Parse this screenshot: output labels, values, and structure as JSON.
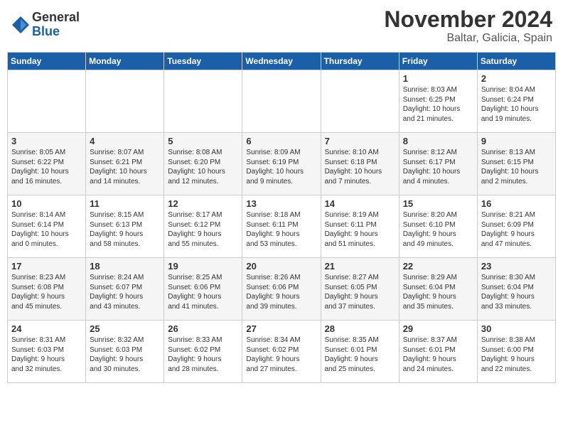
{
  "header": {
    "logo_line1": "General",
    "logo_line2": "Blue",
    "month": "November 2024",
    "location": "Baltar, Galicia, Spain"
  },
  "weekdays": [
    "Sunday",
    "Monday",
    "Tuesday",
    "Wednesday",
    "Thursday",
    "Friday",
    "Saturday"
  ],
  "weeks": [
    [
      {
        "day": "",
        "text": ""
      },
      {
        "day": "",
        "text": ""
      },
      {
        "day": "",
        "text": ""
      },
      {
        "day": "",
        "text": ""
      },
      {
        "day": "",
        "text": ""
      },
      {
        "day": "1",
        "text": "Sunrise: 8:03 AM\nSunset: 6:25 PM\nDaylight: 10 hours\nand 21 minutes."
      },
      {
        "day": "2",
        "text": "Sunrise: 8:04 AM\nSunset: 6:24 PM\nDaylight: 10 hours\nand 19 minutes."
      }
    ],
    [
      {
        "day": "3",
        "text": "Sunrise: 8:05 AM\nSunset: 6:22 PM\nDaylight: 10 hours\nand 16 minutes."
      },
      {
        "day": "4",
        "text": "Sunrise: 8:07 AM\nSunset: 6:21 PM\nDaylight: 10 hours\nand 14 minutes."
      },
      {
        "day": "5",
        "text": "Sunrise: 8:08 AM\nSunset: 6:20 PM\nDaylight: 10 hours\nand 12 minutes."
      },
      {
        "day": "6",
        "text": "Sunrise: 8:09 AM\nSunset: 6:19 PM\nDaylight: 10 hours\nand 9 minutes."
      },
      {
        "day": "7",
        "text": "Sunrise: 8:10 AM\nSunset: 6:18 PM\nDaylight: 10 hours\nand 7 minutes."
      },
      {
        "day": "8",
        "text": "Sunrise: 8:12 AM\nSunset: 6:17 PM\nDaylight: 10 hours\nand 4 minutes."
      },
      {
        "day": "9",
        "text": "Sunrise: 8:13 AM\nSunset: 6:15 PM\nDaylight: 10 hours\nand 2 minutes."
      }
    ],
    [
      {
        "day": "10",
        "text": "Sunrise: 8:14 AM\nSunset: 6:14 PM\nDaylight: 10 hours\nand 0 minutes."
      },
      {
        "day": "11",
        "text": "Sunrise: 8:15 AM\nSunset: 6:13 PM\nDaylight: 9 hours\nand 58 minutes."
      },
      {
        "day": "12",
        "text": "Sunrise: 8:17 AM\nSunset: 6:12 PM\nDaylight: 9 hours\nand 55 minutes."
      },
      {
        "day": "13",
        "text": "Sunrise: 8:18 AM\nSunset: 6:11 PM\nDaylight: 9 hours\nand 53 minutes."
      },
      {
        "day": "14",
        "text": "Sunrise: 8:19 AM\nSunset: 6:11 PM\nDaylight: 9 hours\nand 51 minutes."
      },
      {
        "day": "15",
        "text": "Sunrise: 8:20 AM\nSunset: 6:10 PM\nDaylight: 9 hours\nand 49 minutes."
      },
      {
        "day": "16",
        "text": "Sunrise: 8:21 AM\nSunset: 6:09 PM\nDaylight: 9 hours\nand 47 minutes."
      }
    ],
    [
      {
        "day": "17",
        "text": "Sunrise: 8:23 AM\nSunset: 6:08 PM\nDaylight: 9 hours\nand 45 minutes."
      },
      {
        "day": "18",
        "text": "Sunrise: 8:24 AM\nSunset: 6:07 PM\nDaylight: 9 hours\nand 43 minutes."
      },
      {
        "day": "19",
        "text": "Sunrise: 8:25 AM\nSunset: 6:06 PM\nDaylight: 9 hours\nand 41 minutes."
      },
      {
        "day": "20",
        "text": "Sunrise: 8:26 AM\nSunset: 6:06 PM\nDaylight: 9 hours\nand 39 minutes."
      },
      {
        "day": "21",
        "text": "Sunrise: 8:27 AM\nSunset: 6:05 PM\nDaylight: 9 hours\nand 37 minutes."
      },
      {
        "day": "22",
        "text": "Sunrise: 8:29 AM\nSunset: 6:04 PM\nDaylight: 9 hours\nand 35 minutes."
      },
      {
        "day": "23",
        "text": "Sunrise: 8:30 AM\nSunset: 6:04 PM\nDaylight: 9 hours\nand 33 minutes."
      }
    ],
    [
      {
        "day": "24",
        "text": "Sunrise: 8:31 AM\nSunset: 6:03 PM\nDaylight: 9 hours\nand 32 minutes."
      },
      {
        "day": "25",
        "text": "Sunrise: 8:32 AM\nSunset: 6:03 PM\nDaylight: 9 hours\nand 30 minutes."
      },
      {
        "day": "26",
        "text": "Sunrise: 8:33 AM\nSunset: 6:02 PM\nDaylight: 9 hours\nand 28 minutes."
      },
      {
        "day": "27",
        "text": "Sunrise: 8:34 AM\nSunset: 6:02 PM\nDaylight: 9 hours\nand 27 minutes."
      },
      {
        "day": "28",
        "text": "Sunrise: 8:35 AM\nSunset: 6:01 PM\nDaylight: 9 hours\nand 25 minutes."
      },
      {
        "day": "29",
        "text": "Sunrise: 8:37 AM\nSunset: 6:01 PM\nDaylight: 9 hours\nand 24 minutes."
      },
      {
        "day": "30",
        "text": "Sunrise: 8:38 AM\nSunset: 6:00 PM\nDaylight: 9 hours\nand 22 minutes."
      }
    ]
  ]
}
